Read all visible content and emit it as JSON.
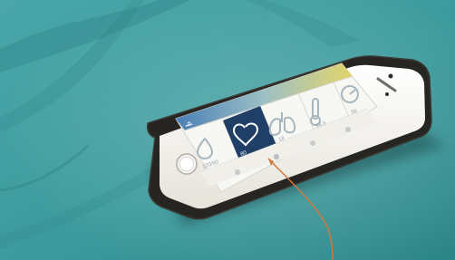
{
  "photo": {
    "subject": "smartphone-on-teal-fabric",
    "colors": {
      "fabric": "#3f9ea0",
      "fabric_shadow": "#2b7f83",
      "phone_frame": "#2b2a28",
      "phone_body": "#f2f0ea",
      "screen_bg": "#f7f7f4",
      "header_gradient_left": "#4a7fb6",
      "header_gradient_right": "#e3d46a",
      "selected_tile": "#1f3f67",
      "pointer_line": "#d07a3d"
    }
  },
  "screen": {
    "tiles": [
      {
        "icon": "drop-icon",
        "value": "120/80"
      },
      {
        "icon": "heart-icon",
        "value": "80"
      },
      {
        "icon": "lungs-icon",
        "value": "18"
      },
      {
        "icon": "thermometer-icon",
        "value": "98.6"
      },
      {
        "icon": "gauge-icon",
        "value": "98"
      }
    ],
    "selected_index": 1
  }
}
